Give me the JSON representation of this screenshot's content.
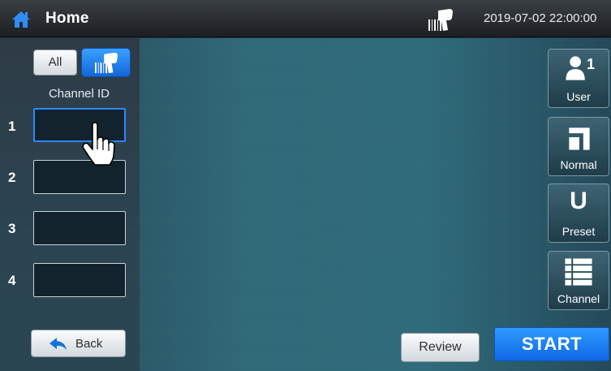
{
  "header": {
    "title": "Home",
    "datetime": "2019-07-02 22:00:00",
    "home_icon": "home-icon",
    "status_icon": "barcode-scanner-icon"
  },
  "channel_panel": {
    "all_label": "All",
    "scan_icon": "barcode-scanner-icon",
    "heading": "Channel ID",
    "channels": [
      {
        "number": "1",
        "value": "",
        "focused": true
      },
      {
        "number": "2",
        "value": "",
        "focused": false
      },
      {
        "number": "3",
        "value": "",
        "focused": false
      },
      {
        "number": "4",
        "value": "",
        "focused": false
      }
    ],
    "back_label": "Back"
  },
  "side_buttons": {
    "user": {
      "label": "User",
      "count": "1",
      "icon": "user-icon"
    },
    "normal": {
      "label": "Normal",
      "icon": "normal-mode-icon"
    },
    "preset": {
      "label": "Preset",
      "letter": "U"
    },
    "channel": {
      "label": "Channel",
      "icon": "list-icon"
    }
  },
  "footer": {
    "review_label": "Review",
    "start_label": "START"
  },
  "colors": {
    "accent": "#1a7ff0",
    "topbar": "#2a2e32",
    "panel": "#2a4350",
    "main": "#2e6a7a"
  }
}
